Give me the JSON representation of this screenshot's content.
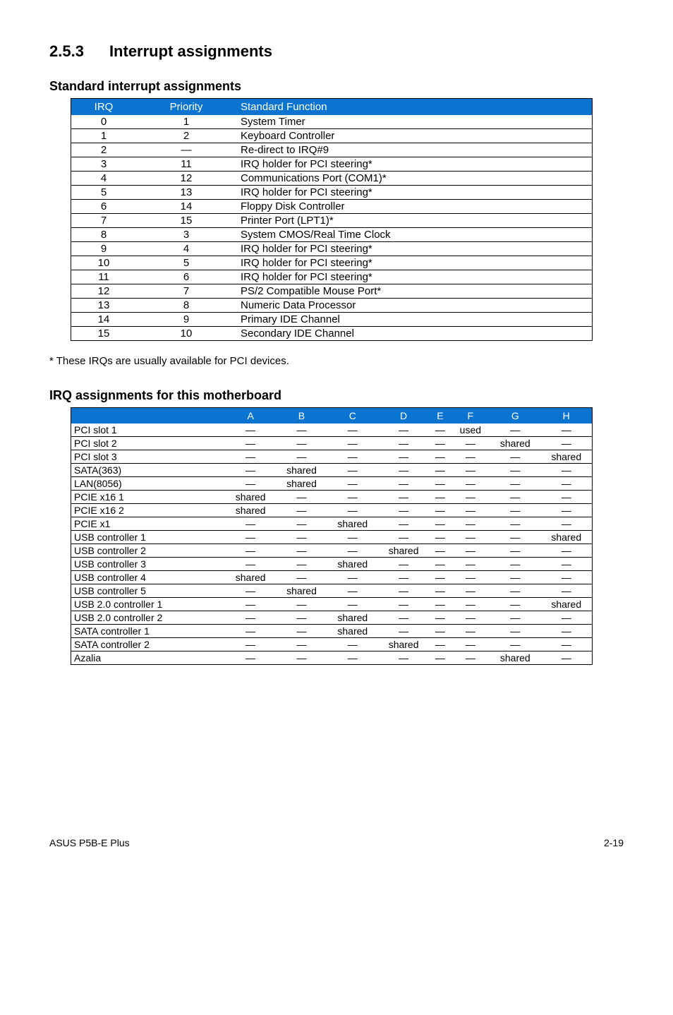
{
  "section": {
    "number": "2.5.3",
    "title": "Interrupt assignments"
  },
  "table1": {
    "title": "Standard interrupt assignments",
    "headers": {
      "irq": "IRQ",
      "priority": "Priority",
      "func": "Standard Function"
    },
    "rows": [
      {
        "irq": "0",
        "priority": "1",
        "func": "System Timer"
      },
      {
        "irq": "1",
        "priority": "2",
        "func": "Keyboard Controller"
      },
      {
        "irq": "2",
        "priority": "—",
        "func": "Re-direct to IRQ#9"
      },
      {
        "irq": "3",
        "priority": "11",
        "func": "IRQ holder for PCI steering*"
      },
      {
        "irq": "4",
        "priority": "12",
        "func": "Communications Port (COM1)*"
      },
      {
        "irq": "5",
        "priority": "13",
        "func": "IRQ holder for PCI steering*"
      },
      {
        "irq": "6",
        "priority": "14",
        "func": "Floppy Disk Controller"
      },
      {
        "irq": "7",
        "priority": "15",
        "func": "Printer Port (LPT1)*"
      },
      {
        "irq": "8",
        "priority": "3",
        "func": "System CMOS/Real Time Clock"
      },
      {
        "irq": "9",
        "priority": "4",
        "func": "IRQ holder for PCI steering*"
      },
      {
        "irq": "10",
        "priority": "5",
        "func": "IRQ holder for PCI steering*"
      },
      {
        "irq": "11",
        "priority": "6",
        "func": "IRQ holder for PCI steering*"
      },
      {
        "irq": "12",
        "priority": "7",
        "func": "PS/2 Compatible Mouse Port*"
      },
      {
        "irq": "13",
        "priority": "8",
        "func": "Numeric Data Processor"
      },
      {
        "irq": "14",
        "priority": "9",
        "func": "Primary IDE Channel"
      },
      {
        "irq": "15",
        "priority": "10",
        "func": "Secondary IDE Channel"
      }
    ]
  },
  "footnote": "* These IRQs are usually available for PCI devices.",
  "table2": {
    "title": "IRQ assignments for this motherboard",
    "headers": [
      "",
      "A",
      "B",
      "C",
      "D",
      "E",
      "F",
      "G",
      "H"
    ],
    "rows": [
      {
        "name": "PCI slot 1",
        "cells": [
          "—",
          "—",
          "—",
          "—",
          "—",
          "used",
          "—",
          "—"
        ]
      },
      {
        "name": "PCI slot 2",
        "cells": [
          "—",
          "—",
          "—",
          "—",
          "—",
          "—",
          "shared",
          "—"
        ]
      },
      {
        "name": "PCI slot 3",
        "cells": [
          "—",
          "—",
          "—",
          "—",
          "—",
          "—",
          "—",
          "shared"
        ]
      },
      {
        "name": "SATA(363)",
        "cells": [
          "—",
          "shared",
          "—",
          "—",
          "—",
          "—",
          "—",
          "—"
        ]
      },
      {
        "name": "LAN(8056)",
        "cells": [
          "—",
          "shared",
          "—",
          "—",
          "—",
          "—",
          "—",
          "—"
        ]
      },
      {
        "name": "PCIE x16 1",
        "cells": [
          "shared",
          "—",
          "—",
          "—",
          "—",
          "—",
          "—",
          "—"
        ]
      },
      {
        "name": "PCIE x16 2",
        "cells": [
          "shared",
          "—",
          "—",
          "—",
          "—",
          "—",
          "—",
          "—"
        ]
      },
      {
        "name": "PCIE x1",
        "cells": [
          "—",
          "—",
          "shared",
          "—",
          "—",
          "—",
          "—",
          "—"
        ]
      },
      {
        "name": "USB controller 1",
        "cells": [
          "—",
          "—",
          "—",
          "—",
          "—",
          "—",
          "—",
          "shared"
        ]
      },
      {
        "name": "USB controller 2",
        "cells": [
          "—",
          "—",
          "—",
          "shared",
          "—",
          "—",
          "—",
          "—"
        ]
      },
      {
        "name": "USB controller 3",
        "cells": [
          "—",
          "—",
          "shared",
          "—",
          "—",
          "—",
          "—",
          "—"
        ]
      },
      {
        "name": "USB controller 4",
        "cells": [
          "shared",
          "—",
          "—",
          "—",
          "—",
          "—",
          "—",
          "—"
        ]
      },
      {
        "name": "USB controller 5",
        "cells": [
          "—",
          "shared",
          "—",
          "—",
          "—",
          "—",
          "—",
          "—"
        ]
      },
      {
        "name": "USB 2.0 controller 1",
        "cells": [
          "—",
          "—",
          "—",
          "—",
          "—",
          "—",
          "—",
          "shared"
        ]
      },
      {
        "name": "USB 2.0 controller 2",
        "cells": [
          "—",
          "—",
          "shared",
          "—",
          "—",
          "—",
          "—",
          "—"
        ]
      },
      {
        "name": "SATA controller 1",
        "cells": [
          "—",
          "—",
          "shared",
          "—",
          "—",
          "—",
          "—",
          "—"
        ]
      },
      {
        "name": "SATA controller 2",
        "cells": [
          "—",
          "—",
          "—",
          "shared",
          "—",
          "—",
          "—",
          "—"
        ]
      },
      {
        "name": "Azalia",
        "cells": [
          "—",
          "—",
          "—",
          "—",
          "—",
          "—",
          "shared",
          "—"
        ]
      }
    ]
  },
  "footer": {
    "left": "ASUS P5B-E Plus",
    "right": "2-19"
  }
}
